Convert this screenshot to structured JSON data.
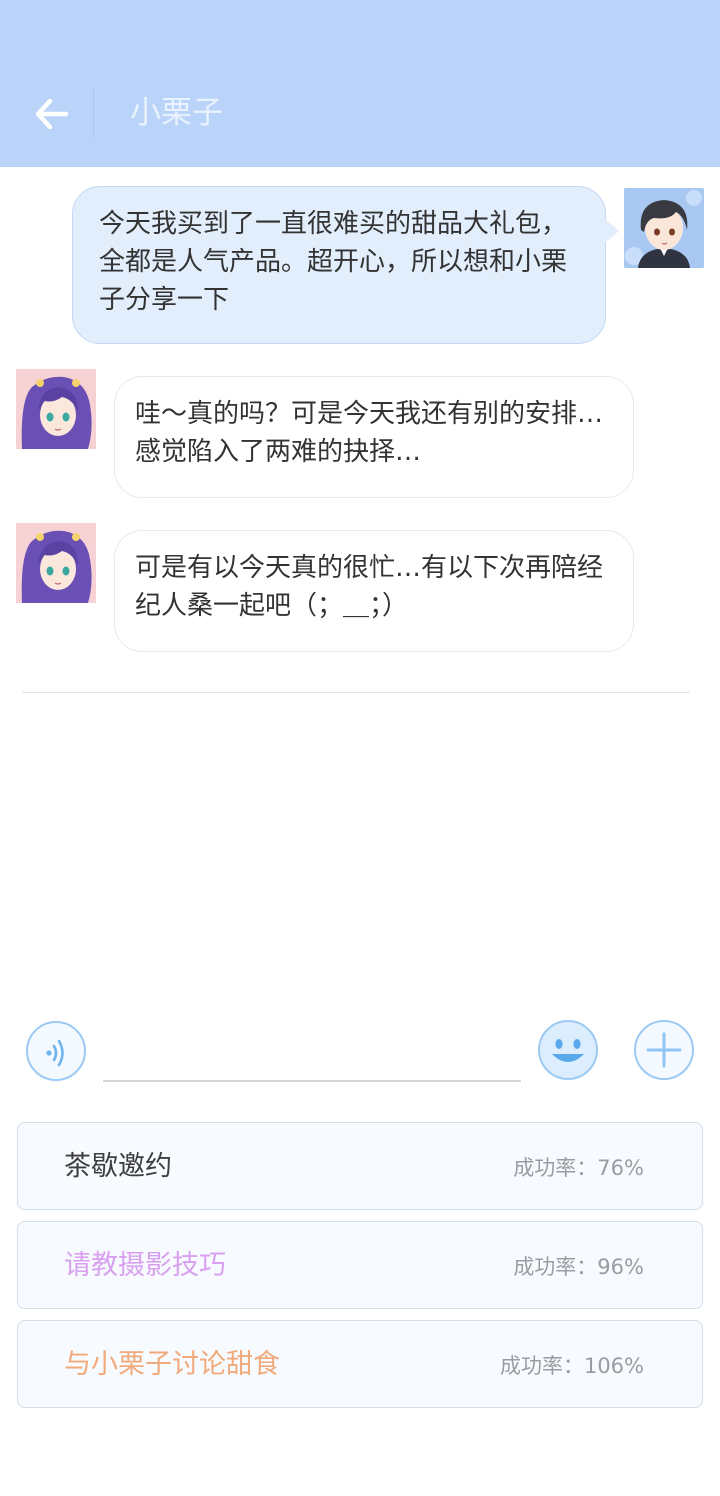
{
  "header": {
    "title": "小栗子"
  },
  "messages": [
    {
      "side": "right",
      "text": "今天我买到了一直很难买的甜品大礼包，全都是人气产品。超开心，所以想和小栗子分享一下"
    },
    {
      "side": "left",
      "text": "哇～真的吗？可是今天我还有别的安排…感觉陷入了两难的抉择…"
    },
    {
      "side": "left",
      "text": "可是有以今天真的很忙…有以下次再陪经纪人桑一起吧（；＿；）"
    }
  ],
  "input": {
    "value": ""
  },
  "options": [
    {
      "label": "茶歇邀约",
      "rate": "成功率：76%"
    },
    {
      "label": "请教摄影技巧",
      "rate": "成功率：96%"
    },
    {
      "label": "与小栗子讨论甜食",
      "rate": "成功率：106%"
    }
  ],
  "colors": {
    "header_bg": "#b9d4f8",
    "bubble_right_bg": "#e2eefc",
    "option_label_1": "#3e3e3e",
    "option_label_2": "#d9a0f0",
    "option_label_3": "#f0aa7c",
    "accent": "#8fc4f5"
  }
}
